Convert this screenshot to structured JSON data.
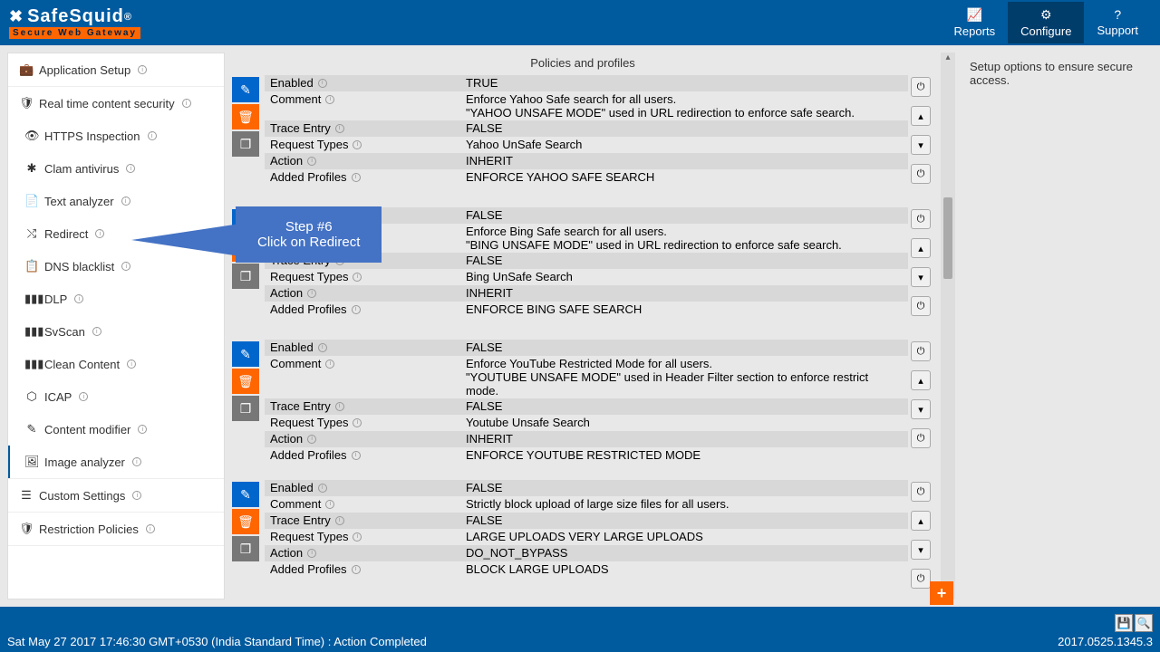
{
  "header": {
    "logo": "SafeSquid",
    "reg": "®",
    "sub": "Secure Web Gateway",
    "nav": {
      "reports": "Reports",
      "configure": "Configure",
      "support": "Support"
    }
  },
  "sidebar": {
    "app_setup": "Application Setup",
    "rtcs": "Real time content security",
    "items": {
      "https": "HTTPS Inspection",
      "clam": "Clam antivirus",
      "text": "Text analyzer",
      "redirect": "Redirect",
      "dns": "DNS blacklist",
      "dlp": "DLP",
      "svscan": "SvScan",
      "clean": "Clean Content",
      "icap": "ICAP",
      "content": "Content modifier",
      "image": "Image analyzer"
    },
    "custom": "Custom Settings",
    "restriction": "Restriction Policies"
  },
  "main": {
    "title": "Policies and profiles",
    "labels": {
      "enabled": "Enabled",
      "comment": "Comment",
      "trace": "Trace Entry",
      "reqtypes": "Request Types",
      "action": "Action",
      "profiles": "Added Profiles"
    },
    "policies": [
      {
        "enabled": "TRUE",
        "comment": "Enforce Yahoo Safe search for all users.\n\"YAHOO UNSAFE MODE\" used in URL redirection to enforce safe search.",
        "trace": "FALSE",
        "reqtypes": "Yahoo UnSafe Search",
        "action": "INHERIT",
        "profiles": "ENFORCE YAHOO SAFE SEARCH"
      },
      {
        "enabled": "FALSE",
        "comment": "Enforce Bing Safe search for all users.\n\"BING UNSAFE MODE\" used in URL redirection to enforce safe search.",
        "trace": "FALSE",
        "reqtypes": "Bing UnSafe Search",
        "action": "INHERIT",
        "profiles": "ENFORCE BING SAFE SEARCH"
      },
      {
        "enabled": "FALSE",
        "comment": "Enforce YouTube Restricted Mode for all users.\n\"YOUTUBE UNSAFE MODE\" used in Header Filter section to enforce restrict mode.",
        "trace": "FALSE",
        "reqtypes": "Youtube Unsafe Search",
        "action": "INHERIT",
        "profiles": "ENFORCE YOUTUBE RESTRICTED MODE"
      },
      {
        "enabled": "FALSE",
        "comment": "Strictly block upload of large size files for all users.",
        "trace": "FALSE",
        "reqtypes": "LARGE UPLOADS   VERY LARGE UPLOADS",
        "action": "DO_NOT_BYPASS",
        "profiles": "BLOCK LARGE UPLOADS"
      }
    ]
  },
  "right_panel": "Setup options to ensure secure access.",
  "callout": {
    "line1": "Step #6",
    "line2": "Click on Redirect"
  },
  "footer": {
    "status": "Sat May 27 2017 17:46:30 GMT+0530 (India Standard Time) : Action Completed",
    "version": "2017.0525.1345.3"
  }
}
